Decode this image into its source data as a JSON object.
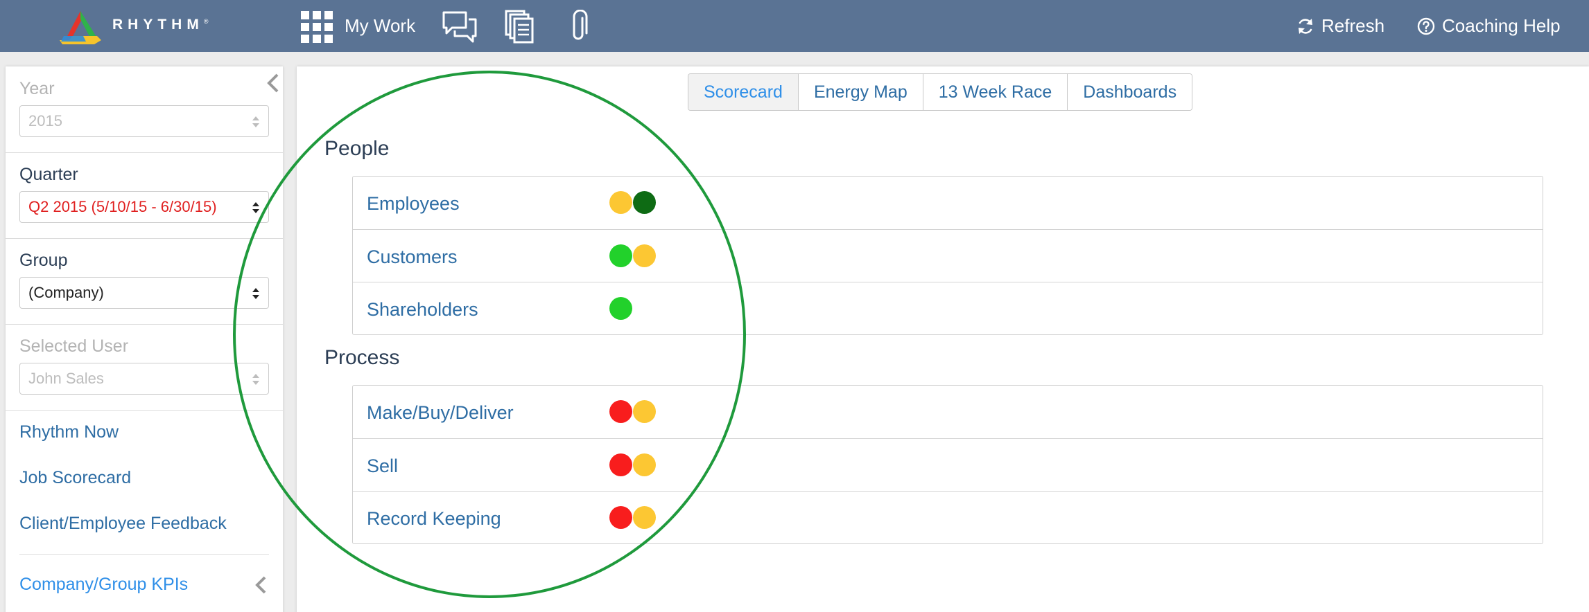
{
  "header": {
    "brand": "RHYTHM",
    "brand_mark": "®",
    "my_work_label": "My Work",
    "refresh_label": "Refresh",
    "help_label": "Coaching Help",
    "icons": [
      "grid-icon",
      "chat-icon",
      "documents-icon",
      "paperclip-icon",
      "refresh-icon",
      "help-icon"
    ]
  },
  "sidebar": {
    "year_label": "Year",
    "year_value": "2015",
    "quarter_label": "Quarter",
    "quarter_value": "Q2 2015 (5/10/15 - 6/30/15)",
    "group_label": "Group",
    "group_value": "(Company)",
    "user_label": "Selected User",
    "user_value": "John Sales",
    "links": [
      "Rhythm Now",
      "Job Scorecard",
      "Client/Employee Feedback"
    ],
    "kpi_label": "Company/Group KPIs"
  },
  "tabs": [
    {
      "label": "Scorecard",
      "active": true
    },
    {
      "label": "Energy Map",
      "active": false
    },
    {
      "label": "13 Week Race",
      "active": false
    },
    {
      "label": "Dashboards",
      "active": false
    }
  ],
  "colors": {
    "yellow": "#fcc733",
    "dark_green": "#0e6b14",
    "green": "#22d12b",
    "red": "#f81d1d",
    "annotation": "#1f9a3c",
    "topbar": "#5a7394"
  },
  "sections": [
    {
      "title": "People",
      "rows": [
        {
          "label": "Employees",
          "dots": [
            "yellow",
            "dark_green"
          ]
        },
        {
          "label": "Customers",
          "dots": [
            "green",
            "yellow"
          ]
        },
        {
          "label": "Shareholders",
          "dots": [
            "green"
          ]
        }
      ]
    },
    {
      "title": "Process",
      "rows": [
        {
          "label": "Make/Buy/Deliver",
          "dots": [
            "red",
            "yellow"
          ]
        },
        {
          "label": "Sell",
          "dots": [
            "red",
            "yellow"
          ]
        },
        {
          "label": "Record Keeping",
          "dots": [
            "red",
            "yellow"
          ]
        }
      ]
    }
  ]
}
